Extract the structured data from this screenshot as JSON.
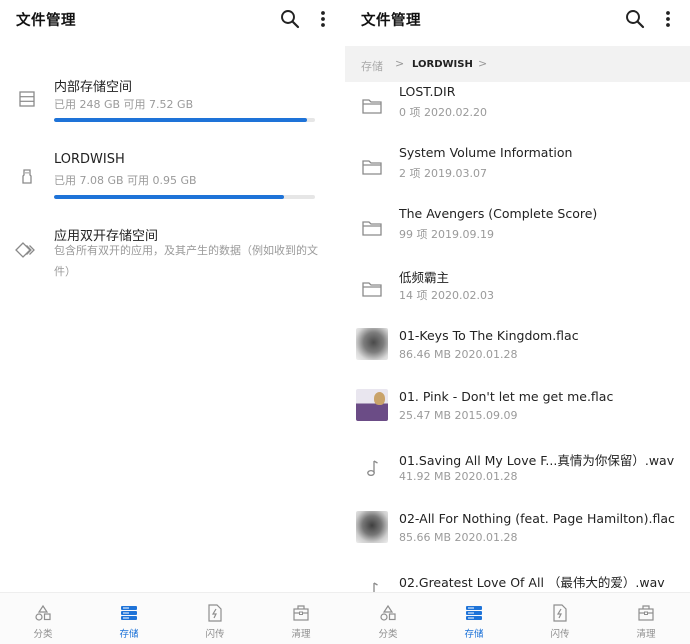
{
  "left": {
    "title": "文件管理",
    "storage": [
      {
        "name": "内部存储空间",
        "detail": "已用 248 GB   可用 7.52 GB",
        "used_fraction": 0.97,
        "icon": "internal-storage-icon"
      },
      {
        "name": "LORDWISH",
        "detail": "已用 7.08 GB   可用 0.95 GB",
        "used_fraction": 0.88,
        "icon": "usb-drive-icon"
      }
    ],
    "dual_app": {
      "name": "应用双开存储空间",
      "description": "包含所有双开的应用，及其产生的数据（例如收到的文件）",
      "icon": "dual-app-icon"
    }
  },
  "right": {
    "title": "文件管理",
    "breadcrumb": {
      "root": "存储",
      "sep1": ">",
      "current": "LORDWISH",
      "sep2": ">"
    },
    "files": [
      {
        "name": "LOST.DIR",
        "meta": "0 项   2020.02.20",
        "kind": "folder"
      },
      {
        "name": "System Volume Information",
        "meta": "2 项   2019.03.07",
        "kind": "folder"
      },
      {
        "name": "The Avengers (Complete Score)",
        "meta": "99 项   2019.09.19",
        "kind": "folder"
      },
      {
        "name": "低频霸主",
        "meta": "14 项   2020.02.03",
        "kind": "folder"
      },
      {
        "name": "01-Keys To The Kingdom.flac",
        "meta": "86.46 MB   2020.01.28",
        "kind": "thumb-keys"
      },
      {
        "name": "01. Pink - Don't let me get me.flac",
        "meta": "25.47 MB   2015.09.09",
        "kind": "thumb-pink"
      },
      {
        "name": "01.Saving All My Love F...真情为你保留）.wav",
        "meta": "41.92 MB   2020.01.28",
        "kind": "music"
      },
      {
        "name": "02-All For Nothing (feat. Page Hamilton).flac",
        "meta": "85.66 MB   2020.01.28",
        "kind": "thumb-nothing"
      },
      {
        "name": "02.Greatest Love Of All （最伟大的爱）.wav",
        "meta": "",
        "kind": "music"
      }
    ]
  },
  "nav": {
    "items": [
      {
        "label": "分类",
        "icon": "category-icon"
      },
      {
        "label": "存储",
        "icon": "storage-icon"
      },
      {
        "label": "闪传",
        "icon": "flash-transfer-icon"
      },
      {
        "label": "清理",
        "icon": "cleanup-icon"
      }
    ],
    "active_index": 1
  },
  "colors": {
    "accent": "#1e73d8",
    "subtext": "#9a9a9a"
  }
}
